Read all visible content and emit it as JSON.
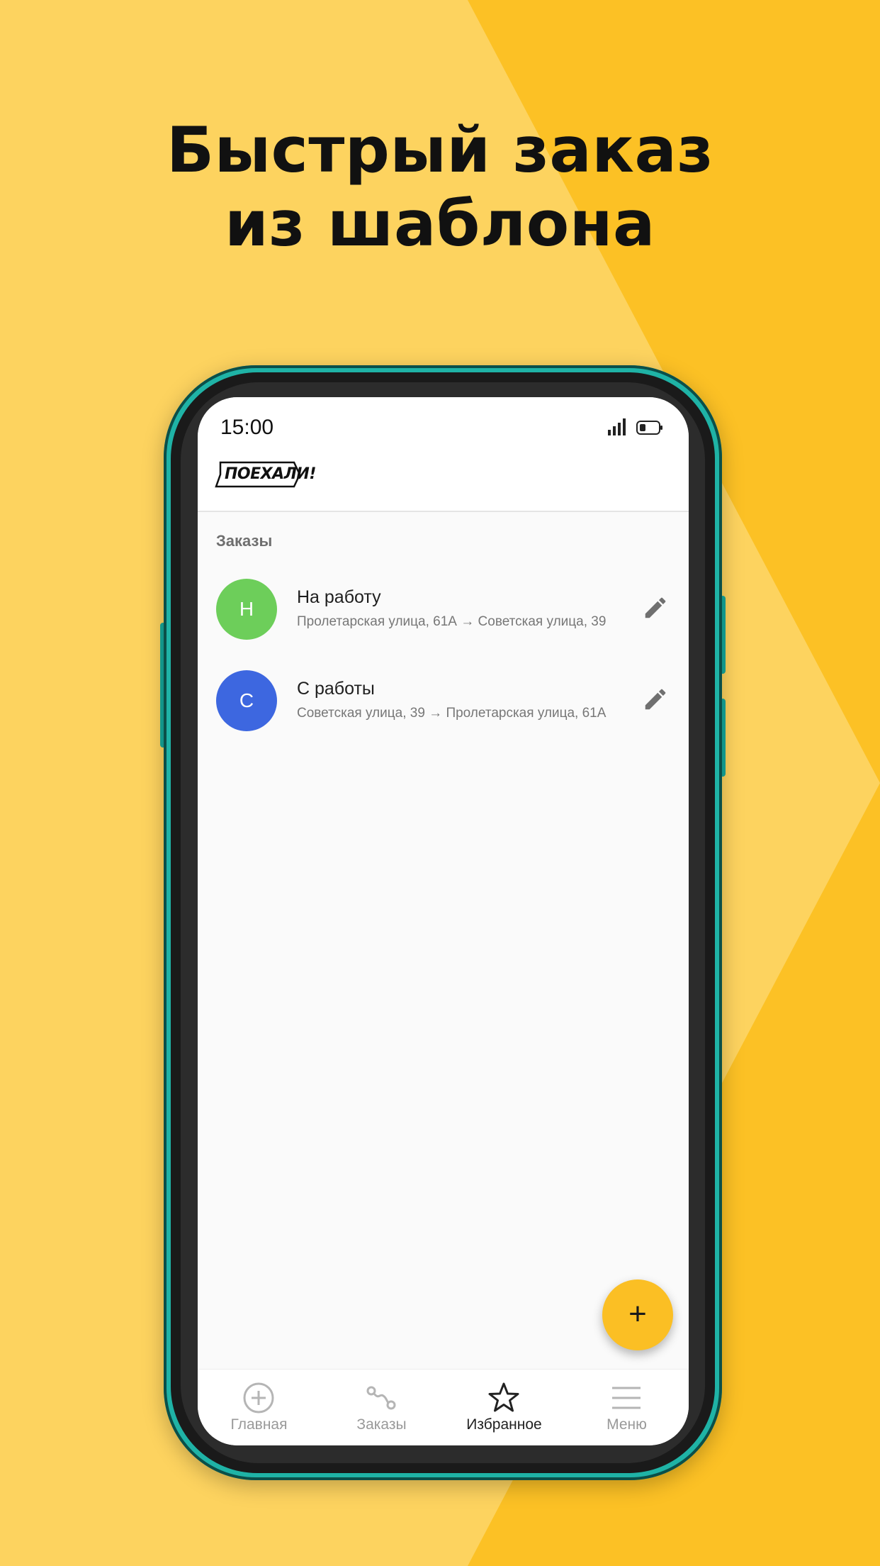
{
  "promo": {
    "line1": "Быстрый заказ",
    "line2": "из шаблона"
  },
  "status_bar": {
    "time": "15:00"
  },
  "app": {
    "logo_text": "ПОЕХАЛИ!"
  },
  "section": {
    "title": "Заказы"
  },
  "templates": [
    {
      "initial": "Н",
      "title": "На работу",
      "route": "Пролетарская улица, 61А → Советская улица, 39",
      "color": "#6dce5a"
    },
    {
      "initial": "С",
      "title": "С работы",
      "route": "Советская улица, 39 → Пролетарская улица, 61А",
      "color": "#3d67e0"
    }
  ],
  "fab": {
    "label": "+",
    "color": "#fbbf24"
  },
  "bottom_nav": {
    "items": [
      {
        "label": "Главная",
        "icon": "plus-circle-icon"
      },
      {
        "label": "Заказы",
        "icon": "route-icon"
      },
      {
        "label": "Избранное",
        "icon": "star-icon",
        "active": true
      },
      {
        "label": "Меню",
        "icon": "menu-icon"
      }
    ]
  },
  "colors": {
    "background": "#fdd35f",
    "accent_shape": "#fcc125",
    "phone_frame": "#1fb3a6"
  }
}
